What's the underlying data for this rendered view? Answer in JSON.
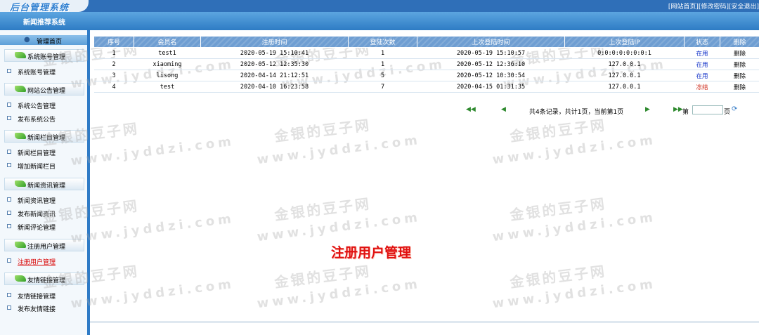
{
  "header": {
    "logo_text": "后台管理系统",
    "links": [
      "[网站首页]",
      "[修改密码]",
      "[安全退出]"
    ]
  },
  "strip": {
    "title": "新闻推荐系统"
  },
  "sidebar": {
    "home": "管理首页",
    "groups": [
      {
        "title": "系统账号管理",
        "items": [
          "系统账号管理"
        ]
      },
      {
        "title": "网站公告管理",
        "items": [
          "系统公告管理",
          "发布系统公告"
        ]
      },
      {
        "title": "新闻栏目管理",
        "items": [
          "新闻栏目管理",
          "增加新闻栏目"
        ]
      },
      {
        "title": "新闻资讯管理",
        "items": [
          "新闻资讯管理",
          "发布新闻资讯",
          "新闻评论管理"
        ]
      },
      {
        "title": "注册用户管理",
        "items": [
          "注册用户管理"
        ]
      },
      {
        "title": "友情链接管理",
        "items": [
          "友情链接管理",
          "发布友情链接"
        ]
      }
    ],
    "active_item": "注册用户管理"
  },
  "table": {
    "headers": [
      "序号",
      "会员名",
      "注册时间",
      "登陆次数",
      "上次登陆时间",
      "上次登陆IP",
      "状态",
      "删除"
    ],
    "rows": [
      [
        "1",
        "test1",
        "2020-05-19 15:10:41",
        "1",
        "2020-05-19 15:10:57",
        "0:0:0:0:0:0:0:1",
        "在用",
        "删除"
      ],
      [
        "2",
        "xiaoming",
        "2020-05-12 12:35:30",
        "1",
        "2020-05-12 12:36:10",
        "127.0.0.1",
        "在用",
        "删除"
      ],
      [
        "3",
        "lisong",
        "2020-04-14 21:12:51",
        "5",
        "2020-05-12 10:30:54",
        "127.0.0.1",
        "在用",
        "删除"
      ],
      [
        "4",
        "test",
        "2020-04-10 16:23:58",
        "7",
        "2020-04-15 01:31:35",
        "127.0.0.1",
        "冻结",
        "删除"
      ]
    ]
  },
  "pager": {
    "info": "共4条记录，共计1页，当前第1页",
    "page_label": "第",
    "page_suffix": "页",
    "page_input": ""
  },
  "page_heading": "注册用户管理",
  "watermark": {
    "cn": "金银的豆子网",
    "en": "www.jyddzi.com"
  },
  "colors": {
    "topbar": "#2f6fb8",
    "status_active": "#1030c8",
    "status_frozen": "#d03020",
    "heading": "#e01010"
  },
  "icons": {
    "first": "first-page-icon",
    "prev": "prev-page-icon",
    "next": "next-page-icon",
    "last": "last-page-icon",
    "go": "refresh-go-icon"
  }
}
